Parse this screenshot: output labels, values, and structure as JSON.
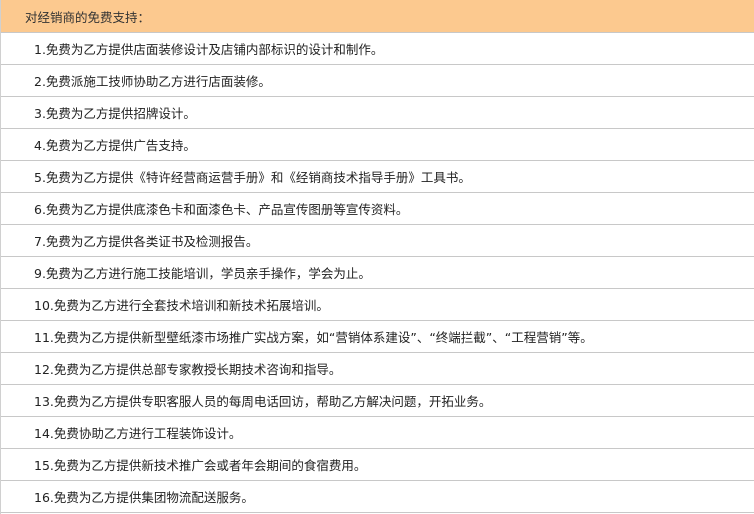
{
  "header": {
    "title": "对经销商的免费支持："
  },
  "items": [
    "1.免费为乙方提供店面装修设计及店铺内部标识的设计和制作。",
    "2.免费派施工技师协助乙方进行店面装修。",
    "3.免费为乙方提供招牌设计。",
    "4.免费为乙方提供广告支持。",
    "5.免费为乙方提供《特许经营商运营手册》和《经销商技术指导手册》工具书。",
    "6.免费为乙方提供底漆色卡和面漆色卡、产品宣传图册等宣传资料。",
    "7.免费为乙方提供各类证书及检测报告。",
    "9.免费为乙方进行施工技能培训，学员亲手操作，学会为止。",
    "10.免费为乙方进行全套技术培训和新技术拓展培训。",
    "11.免费为乙方提供新型壁纸漆市场推广实战方案，如“营销体系建设”、“终端拦截”、“工程营销”等。",
    "12.免费为乙方提供总部专家教授长期技术咨询和指导。",
    "13.免费为乙方提供专职客服人员的每周电话回访，帮助乙方解决问题，开拓业务。",
    "14.免费协助乙方进行工程装饰设计。",
    "15.免费为乙方提供新技术推广会或者年会期间的食宿费用。",
    "16.免费为乙方提供集团物流配送服务。"
  ],
  "colors": {
    "header_background": "#fcc98f",
    "grid_line": "#c8c8c8"
  }
}
